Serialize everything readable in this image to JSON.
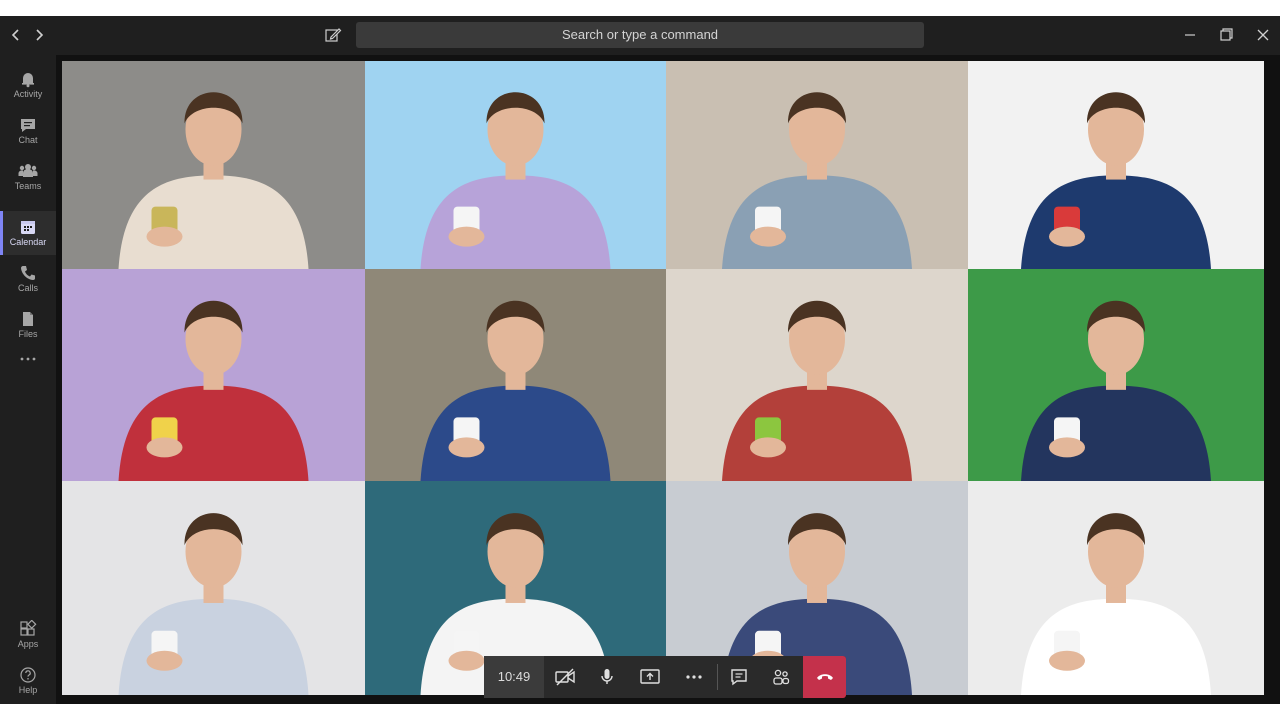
{
  "search": {
    "placeholder": "Search or type a command"
  },
  "rail": {
    "items": [
      {
        "label": "Activity",
        "icon": "bell-icon"
      },
      {
        "label": "Chat",
        "icon": "chat-icon"
      },
      {
        "label": "Teams",
        "icon": "teams-icon"
      },
      {
        "label": "Calendar",
        "icon": "calendar-icon",
        "active": true
      },
      {
        "label": "Calls",
        "icon": "phone-icon"
      },
      {
        "label": "Files",
        "icon": "files-icon"
      }
    ],
    "bottom": [
      {
        "label": "Apps",
        "icon": "apps-icon"
      },
      {
        "label": "Help",
        "icon": "help-icon"
      }
    ]
  },
  "call": {
    "time": "10:49"
  },
  "participants": [
    {
      "icon": "participant-video",
      "bg": "#8d8c89",
      "shirt": "#e8ddd0",
      "cup": "#c9b65a"
    },
    {
      "icon": "participant-video",
      "bg": "#9fd3f1",
      "shirt": "#b7a3d9",
      "cup": "#f5f5f5"
    },
    {
      "icon": "participant-video",
      "bg": "#c9bfb2",
      "shirt": "#8aa0b4",
      "cup": "#f5f5f5"
    },
    {
      "icon": "participant-video",
      "bg": "#f2f2f2",
      "shirt": "#1e3a6e",
      "cup": "#d93a3a"
    },
    {
      "icon": "participant-video",
      "bg": "#b8a2d6",
      "shirt": "#c0303c",
      "cup": "#f0d24a"
    },
    {
      "icon": "participant-video",
      "bg": "#8f8878",
      "shirt": "#2c4a8a",
      "cup": "#f5f5f5"
    },
    {
      "icon": "participant-video",
      "bg": "#ddd6cc",
      "shirt": "#b3403a",
      "cup": "#8cc63f"
    },
    {
      "icon": "participant-video",
      "bg": "#3d9a48",
      "shirt": "#23355e",
      "cup": "#f5f5f5"
    },
    {
      "icon": "participant-video",
      "bg": "#e4e4e6",
      "shirt": "#c9d2e0",
      "cup": "#f5f5f5"
    },
    {
      "icon": "participant-video",
      "bg": "#2e6a7a",
      "shirt": "#f4f4f4",
      "cup": "#f5f5f5"
    },
    {
      "icon": "participant-video",
      "bg": "#c8ccd2",
      "shirt": "#3a4a7a",
      "cup": "#f5f5f5"
    },
    {
      "icon": "participant-video",
      "bg": "#ececec",
      "shirt": "#ffffff",
      "cup": "#f5f5f5"
    }
  ],
  "colors": {
    "accent": "#7f85f5",
    "leave": "#c4314b"
  }
}
